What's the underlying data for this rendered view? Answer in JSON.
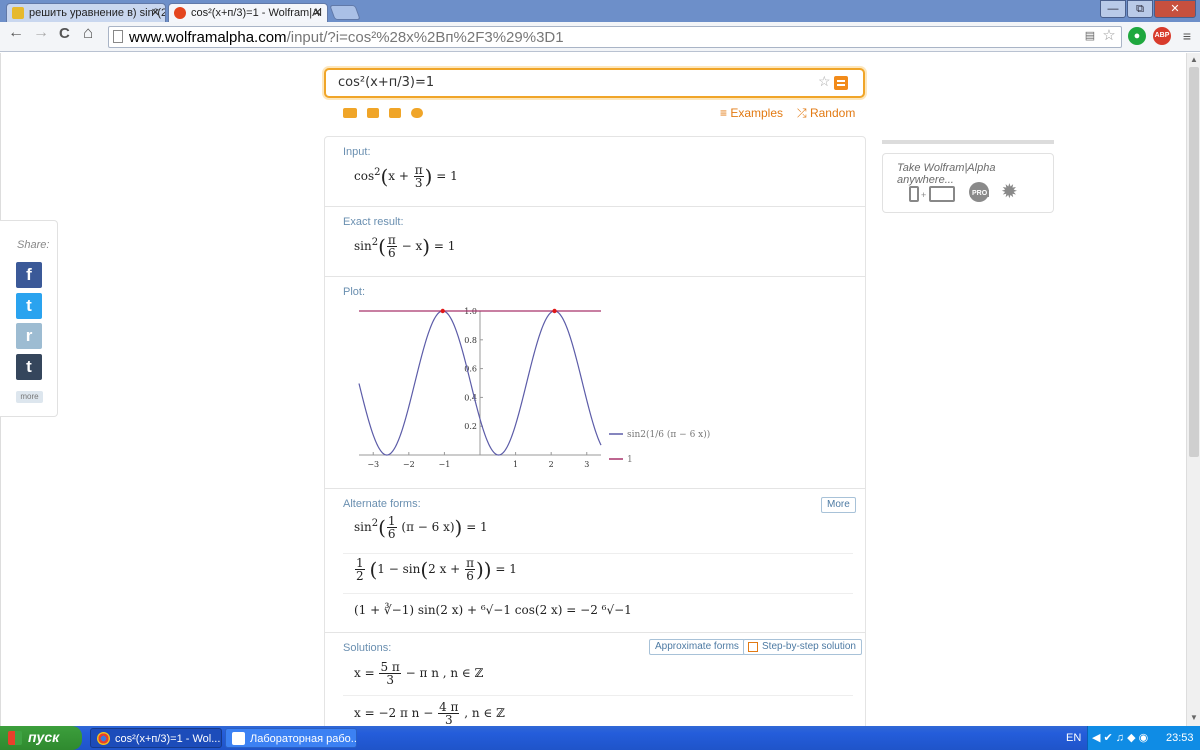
{
  "browser": {
    "tabs": [
      {
        "title": "решить уравнение в) sin²(2",
        "fav_color": "#e6b92e"
      },
      {
        "title": "cos²(x+п/3)=1 - Wolfram|Al",
        "fav_color": "#e4451e"
      }
    ],
    "tab_close": "✕",
    "window_buttons": {
      "minimize": "—",
      "maximize": "⧉",
      "close": "✕"
    },
    "url_domain": "www.wolframalpha.com",
    "url_path": "/input/?i=cos²%28x%2Bп%2F3%29%3D1",
    "extensions": {
      "abp": "ABP"
    }
  },
  "nav": {
    "back": "←",
    "forward": "→",
    "reload": "C",
    "home": "⌂"
  },
  "search": {
    "query": "cos²(x+п/3)=1",
    "star": "☆"
  },
  "links": {
    "examples": "≡ Examples",
    "random": "⤮ Random"
  },
  "pods": {
    "input": {
      "title": "Input:"
    },
    "exact": {
      "title": "Exact result:"
    },
    "plot": {
      "title": "Plot:"
    },
    "alternate": {
      "title": "Alternate forms:",
      "more": "More"
    },
    "solutions": {
      "title": "Solutions:",
      "approx": "Approximate forms",
      "step": "Step-by-step solution"
    }
  },
  "math_text": {
    "input_lhs": "cos",
    "sup2": "2",
    "x_plus": "x +",
    "pi": "π",
    "three": "3",
    "six": "6",
    "one": "1",
    "two": "2",
    "eq1": "= 1",
    "sin": "sin",
    "minus_x": "− x",
    "pi_minus_6x": "(π − 6 x)",
    "one_minus_sin": "1 − sin",
    "two_x_plus": "2 x +",
    "alt3": "(1 + ∛−1) sin(2 x) + ⁶√−1 cos(2 x) = −2 ⁶√−1",
    "sol1_x": "x =",
    "five_pi": "5 π",
    "sol1_rest": "− π n ,    n ∈ ℤ",
    "sol2_x": "x = −2 π n −",
    "four_pi": "4 π",
    "sol2_rest": ",    n ∈ ℤ"
  },
  "chart_data": {
    "type": "line",
    "title": "",
    "xlabel": "",
    "ylabel": "",
    "xlim": [
      -3.4,
      3.4
    ],
    "ylim": [
      0,
      1.0
    ],
    "xticks": [
      "−3",
      "−2",
      "−1",
      "1",
      "2",
      "3"
    ],
    "yticks": [
      "0.2",
      "0.4",
      "0.6",
      "0.8",
      "1.0"
    ],
    "series": [
      {
        "function": "sin^2((pi - 6x)/6)",
        "color": "#5c5ca8"
      },
      {
        "function": "1",
        "color": "#a8336b"
      }
    ],
    "points": [
      [
        -1.0472,
        1.0
      ],
      [
        2.0944,
        1.0
      ]
    ],
    "legend": {
      "placement": "right",
      "entries": [
        "sin²( 1/6 (π − 6 x))",
        "1"
      ]
    }
  },
  "legend_text": {
    "sin": "sin",
    "sup2": "2",
    "n": "1",
    "d": "6",
    "rest": "(π − 6 x)",
    "one": "1"
  },
  "pro": {
    "text": "Take Wolfram|Alpha anywhere...",
    "pro_label": "PRO"
  },
  "share": {
    "title": "Share:",
    "facebook": "f",
    "twitter": "t",
    "reddit": "r",
    "tumblr": "t",
    "more": "more"
  },
  "taskbar": {
    "start": "пуск",
    "tasks": [
      "cos²(x+п/3)=1 - Wol...",
      "Лабораторная рабо..."
    ],
    "lang": "EN",
    "time": "23:53"
  }
}
